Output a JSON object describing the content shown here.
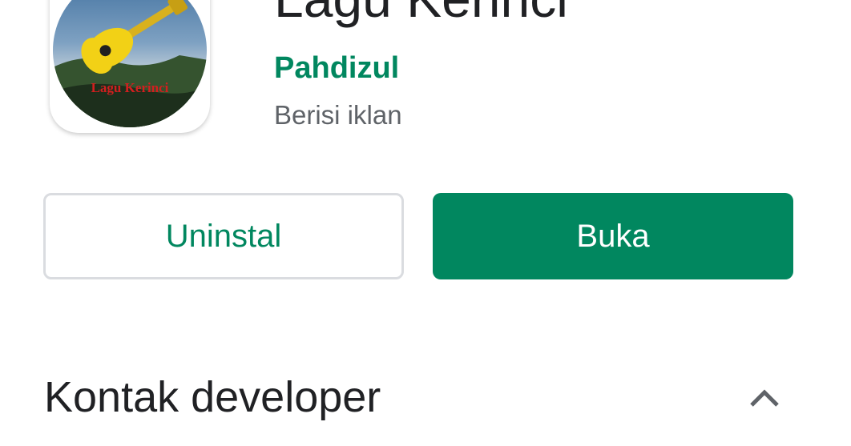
{
  "app": {
    "title": "Lagu Kerinci",
    "developer": "Pahdizul",
    "ads_notice": "Berisi iklan",
    "icon_text": "Lagu Kerinci",
    "icon_name": "guitar-logo-icon"
  },
  "actions": {
    "uninstall_label": "Uninstal",
    "open_label": "Buka"
  },
  "sections": {
    "developer_contact_title": "Kontak developer",
    "toggle_icon": "chevron-up-icon"
  },
  "colors": {
    "accent": "#01875f",
    "text_primary": "#202124",
    "text_secondary": "#5f6368",
    "border": "#dadce0"
  }
}
